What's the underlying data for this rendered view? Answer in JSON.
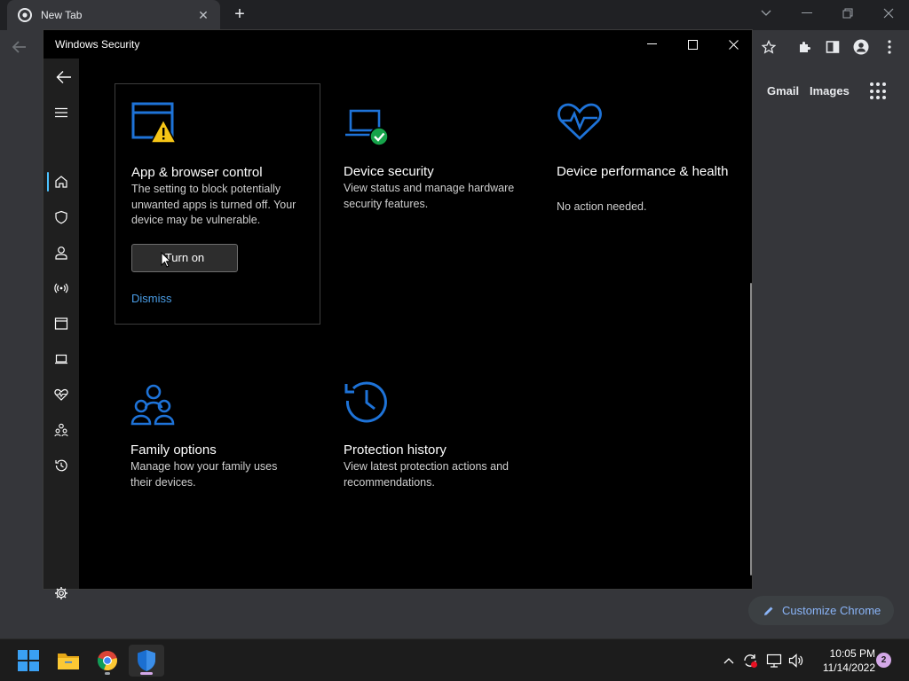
{
  "chrome": {
    "tab_title": "New Tab",
    "tab_close": "✕",
    "new_tab": "+",
    "ntp_links": {
      "gmail": "Gmail",
      "images": "Images"
    },
    "customize_label": "Customize Chrome"
  },
  "window": {
    "title": "Windows Security"
  },
  "cards": {
    "app_browser": {
      "title": "App & browser control",
      "desc": "The setting to block potentially unwanted apps is turned off. Your device may be vulnerable.",
      "button_label": "Turn on",
      "dismiss_label": "Dismiss"
    },
    "device_security": {
      "title": "Device security",
      "desc": "View status and manage hardware security features."
    },
    "device_performance": {
      "title": "Device performance & health",
      "desc": "No action needed."
    },
    "family_options": {
      "title": "Family options",
      "desc": "Manage how your family uses their devices."
    },
    "protection_history": {
      "title": "Protection history",
      "desc": "View latest protection actions and recommendations."
    }
  },
  "taskbar": {
    "time": "10:05 PM",
    "date": "11/14/2022",
    "notification_count": "2"
  },
  "colors": {
    "accent_blue": "#1e73d8",
    "warning_yellow": "#f6c516",
    "ok_green": "#16a34a",
    "link_blue": "#4a9ee8"
  }
}
